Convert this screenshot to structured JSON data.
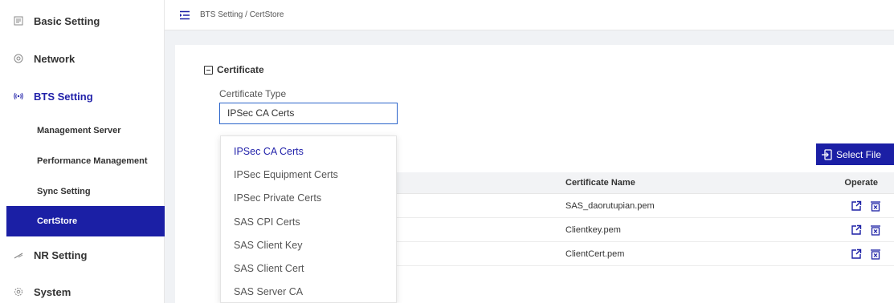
{
  "sidebar": {
    "items": [
      {
        "label": "Basic Setting",
        "icon": "document-icon"
      },
      {
        "label": "Network",
        "icon": "network-icon"
      },
      {
        "label": "BTS Setting",
        "icon": "antenna-icon",
        "active": true
      },
      {
        "label": "NR Setting",
        "icon": "signal-icon"
      },
      {
        "label": "System",
        "icon": "gear-icon"
      }
    ],
    "subitems": [
      {
        "label": "Management Server"
      },
      {
        "label": "Performance Management"
      },
      {
        "label": "Sync Setting"
      },
      {
        "label": "CertStore",
        "selected": true
      }
    ]
  },
  "header": {
    "breadcrumb": "BTS Setting / CertStore"
  },
  "main": {
    "section_title": "Certificate",
    "type_label": "Certificate Type",
    "type_value": "IPSec CA Certs",
    "select_file_label": "Select File",
    "table": {
      "columns": [
        "Certificate Name",
        "Operate"
      ],
      "rows": [
        {
          "name": "SAS_daorutupian.pem"
        },
        {
          "name": "Clientkey.pem"
        },
        {
          "name": "ClientCert.pem"
        }
      ]
    },
    "dropdown": {
      "options": [
        "IPSec CA Certs",
        "IPSec Equipment Certs",
        "IPSec Private Certs",
        "SAS CPI Certs",
        "SAS Client Key",
        "SAS Client Cert",
        "SAS Server CA"
      ],
      "selected_index": 0
    }
  },
  "colors": {
    "accent": "#1b1fa5",
    "active_text": "#2222aa",
    "input_border": "#2a63c9"
  }
}
